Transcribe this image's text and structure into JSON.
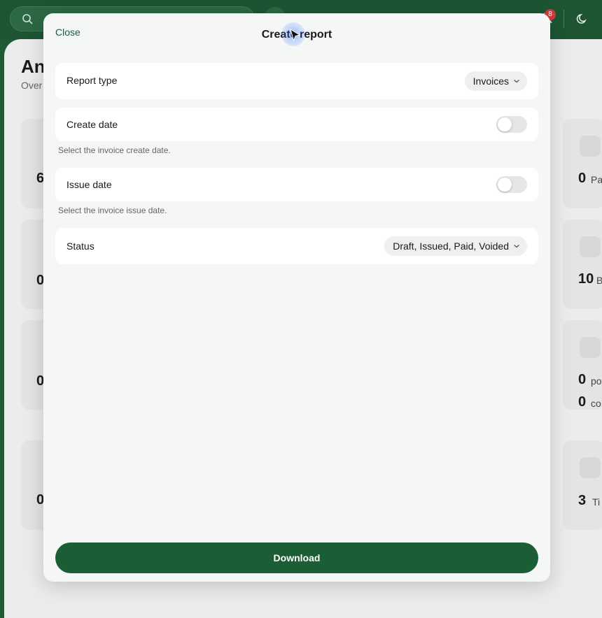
{
  "topbar": {
    "notification_count": "8"
  },
  "background": {
    "page_title": "An",
    "page_subtitle": "Over",
    "left_values": [
      "6",
      "0",
      "0",
      "0"
    ],
    "right_cards": [
      {
        "icon": "dollar-doc-icon",
        "value": "0",
        "unit": "Pa"
      },
      {
        "icon": "monitor-icon",
        "value": "10",
        "unit": "B"
      },
      {
        "icon": "rss-icon",
        "value": "0",
        "unit": "po",
        "value2": "0",
        "unit2": "co"
      },
      {
        "icon": "ticket-icon",
        "value": "3",
        "unit": "Ti"
      }
    ]
  },
  "modal": {
    "close_label": "Close",
    "title": "Create report",
    "report_type": {
      "label": "Report type",
      "value": "Invoices"
    },
    "create_date": {
      "label": "Create date",
      "enabled": false,
      "hint": "Select the invoice create date."
    },
    "issue_date": {
      "label": "Issue date",
      "enabled": false,
      "hint": "Select the invoice issue date."
    },
    "status": {
      "label": "Status",
      "value": "Draft, Issued, Paid, Voided"
    },
    "download_label": "Download"
  },
  "colors": {
    "brand": "#1b5e35",
    "badge": "#d33b3b"
  }
}
